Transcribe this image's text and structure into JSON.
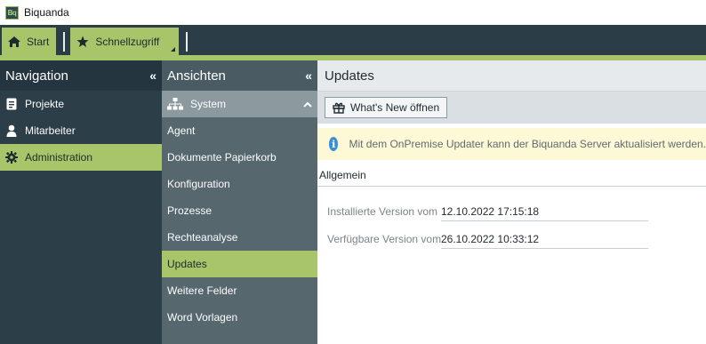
{
  "app": {
    "logo_text": "Bq",
    "title": "Biquanda"
  },
  "toolbar": {
    "tabs": [
      {
        "label": "Start",
        "icon": "home-icon"
      },
      {
        "label": "Schnellzugriff",
        "icon": "star-icon"
      }
    ]
  },
  "navigation": {
    "title": "Navigation",
    "collapse": "«",
    "items": [
      {
        "label": "Projekte",
        "icon": "clipboard-icon",
        "active": false
      },
      {
        "label": "Mitarbeiter",
        "icon": "user-icon",
        "active": false
      },
      {
        "label": "Administration",
        "icon": "gear-icon",
        "active": true
      }
    ]
  },
  "views": {
    "title": "Ansichten",
    "collapse": "«",
    "group": {
      "label": "System",
      "icon": "sitemap-icon",
      "toggle": "^"
    },
    "items": [
      {
        "label": "Agent"
      },
      {
        "label": "Dokumente Papierkorb"
      },
      {
        "label": "Konfiguration"
      },
      {
        "label": "Prozesse"
      },
      {
        "label": "Rechteanalyse"
      },
      {
        "label": "Updates",
        "active": true
      },
      {
        "label": "Weitere Felder"
      },
      {
        "label": "Word Vorlagen"
      }
    ]
  },
  "content": {
    "title": "Updates",
    "whats_new_button": "What's New öffnen",
    "info_icon": "i",
    "info_text": "Mit dem OnPremise Updater kann der Biquanda Server aktualisiert werden.",
    "section_title": "Allgemein",
    "fields": [
      {
        "label": "Installierte Version vom",
        "value": "12.10.2022 17:15:18"
      },
      {
        "label": "Verfügbare Version vom",
        "value": "26.10.2022 10:33:12"
      }
    ]
  },
  "colors": {
    "accent": "#a9c56a",
    "nav_bg": "#2c3e47",
    "views_bg": "#56676e",
    "info_bg": "#fdf9d7",
    "info_icon": "#3d8fd4"
  }
}
